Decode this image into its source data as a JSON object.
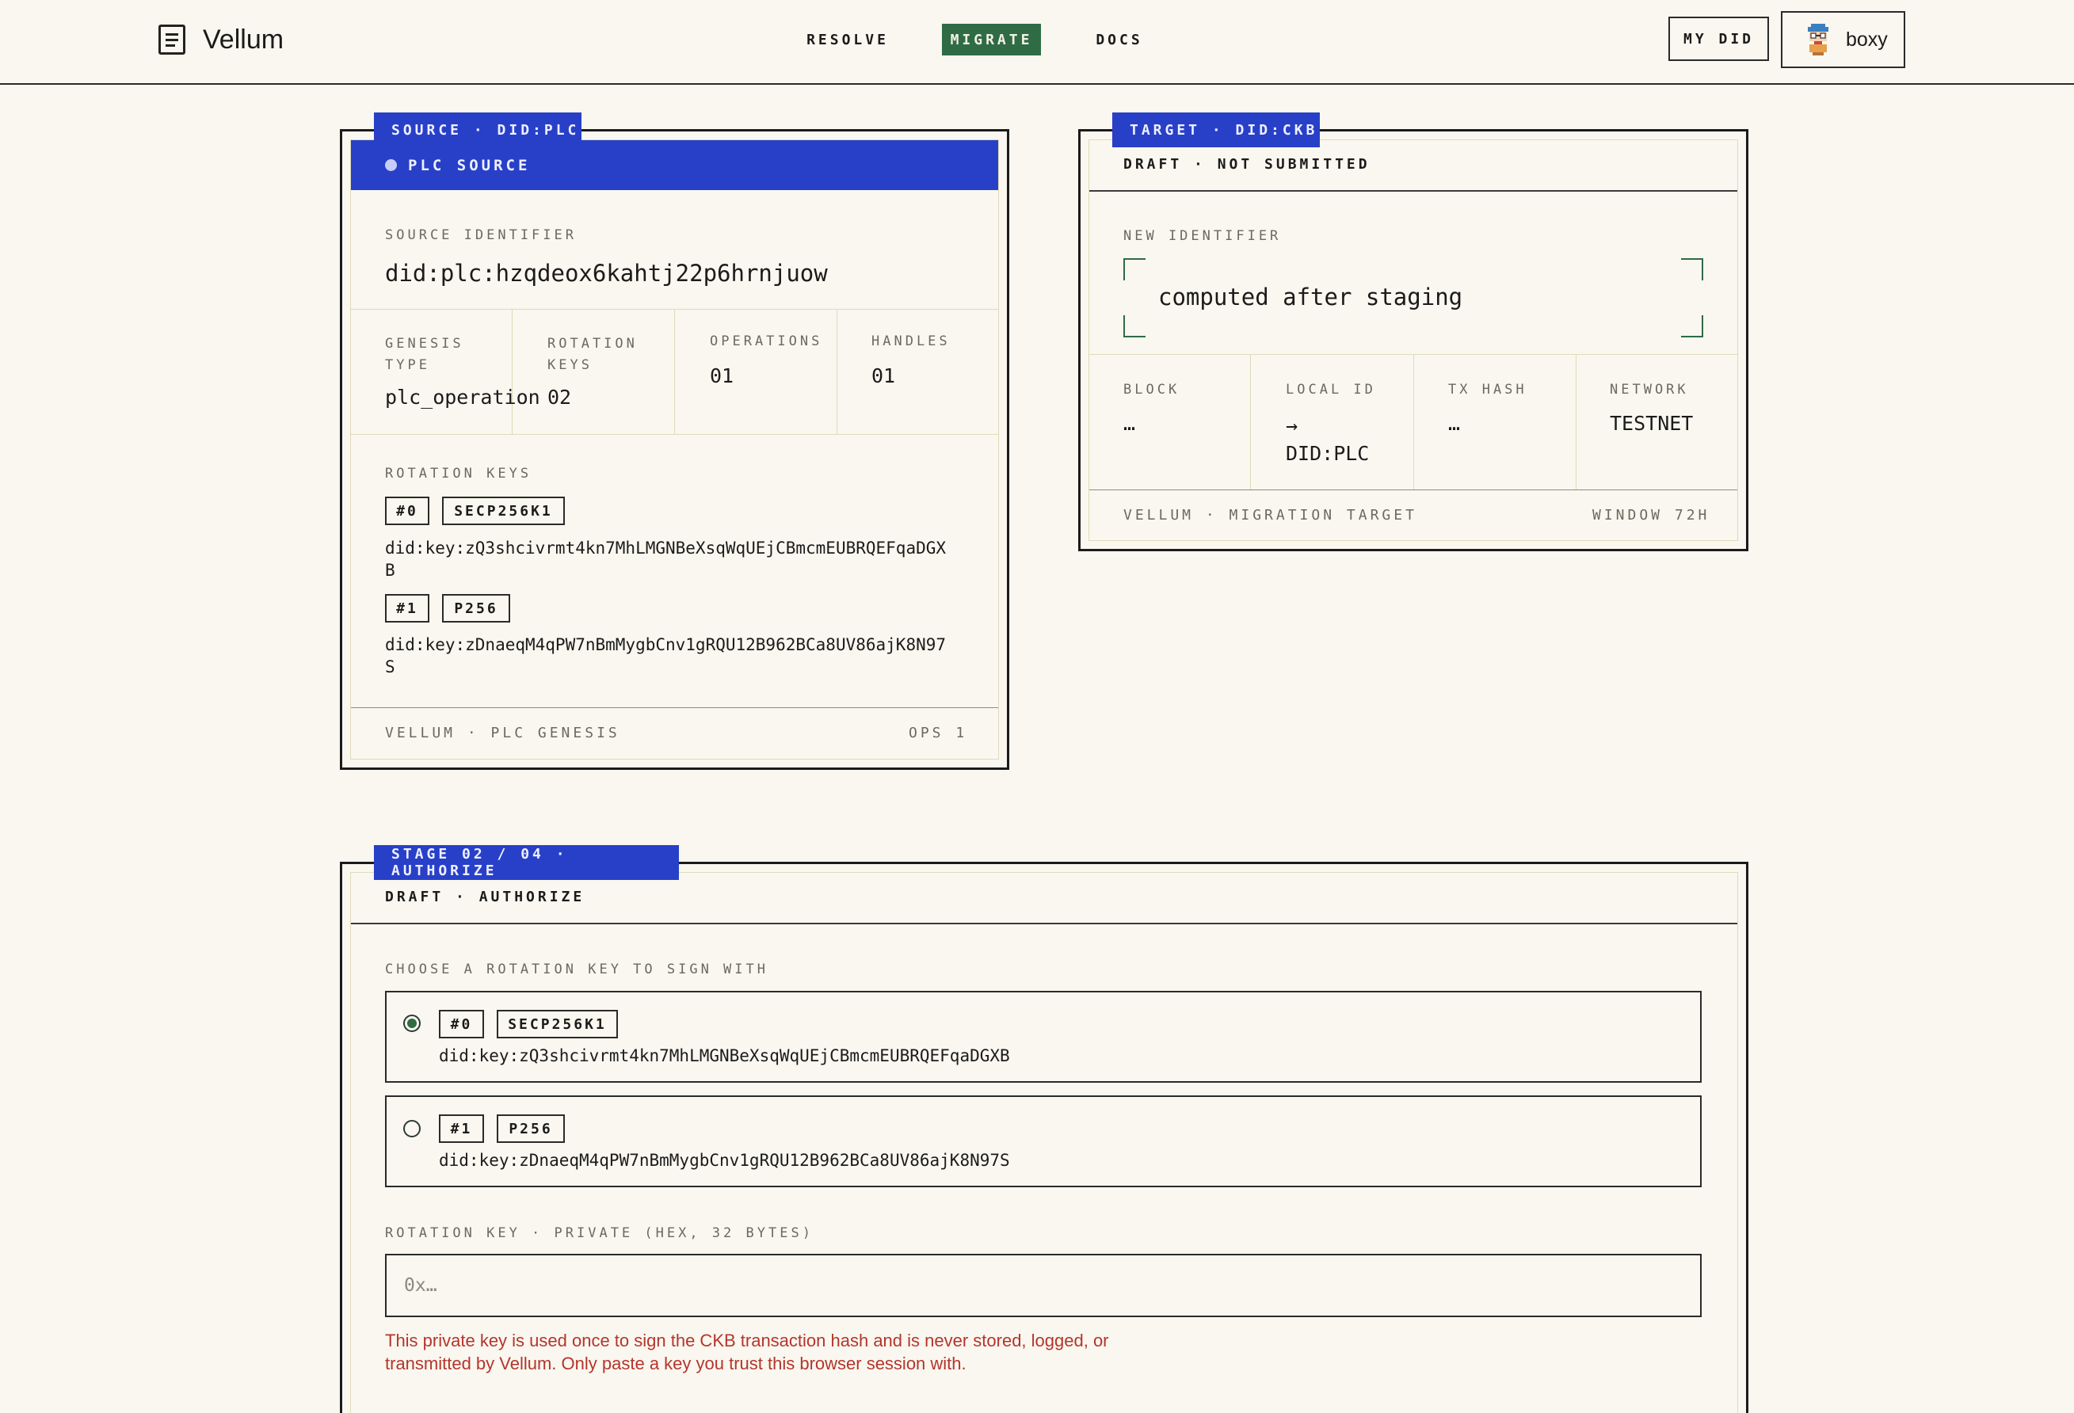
{
  "app": {
    "name": "Vellum",
    "nav": [
      {
        "label": "RESOLVE"
      },
      {
        "label": "MIGRATE"
      },
      {
        "label": "DOCS"
      }
    ],
    "my_did_label": "MY DID",
    "user_name": "boxy"
  },
  "source": {
    "tag": "SOURCE · DID:PLC",
    "banner": "PLC SOURCE",
    "identifier_label": "SOURCE IDENTIFIER",
    "identifier": "did:plc:hzqdeox6kahtj22p6hrnjuow",
    "stats": [
      {
        "label_line1": "GENESIS",
        "label_line2": "TYPE",
        "value": "plc_operation"
      },
      {
        "label_line1": "ROTATION",
        "label_line2": "KEYS",
        "value": "02"
      },
      {
        "label_line1": "OPERATIONS",
        "value": "01"
      },
      {
        "label_line1": "HANDLES",
        "value": "01"
      }
    ],
    "rotation_keys_label": "ROTATION KEYS",
    "keys": [
      {
        "index": "#0",
        "algo": "SECP256K1",
        "key_line1": "did:key:zQ3shcivrmt4kn7MhLMGNBeXsqWqUEjCBmcmEUBRQEFqaDGX",
        "key_line2": "B"
      },
      {
        "index": "#1",
        "algo": "P256",
        "key_line1": "did:key:zDnaeqM4qPW7nBmMygbCnv1gRQU12B962BCa8UV86ajK8N97",
        "key_line2": "S"
      }
    ],
    "footer_left": "VELLUM · PLC GENESIS",
    "footer_right": "OPS 1"
  },
  "target": {
    "tag": "TARGET · DID:CKB",
    "status": "DRAFT · NOT SUBMITTED",
    "new_identifier_label": "NEW IDENTIFIER",
    "new_identifier_value": "computed after staging",
    "fields": [
      {
        "label": "BLOCK",
        "value": "…"
      },
      {
        "label": "LOCAL ID",
        "value_line1": "→",
        "value_line2": "DID:PLC"
      },
      {
        "label": "TX HASH",
        "value": "…"
      },
      {
        "label": "NETWORK",
        "value": "TESTNET"
      }
    ],
    "footer_left": "VELLUM · MIGRATION TARGET",
    "footer_right": "WINDOW 72H"
  },
  "stage": {
    "tag": "STAGE 02 / 04 · AUTHORIZE",
    "status": "DRAFT · AUTHORIZE",
    "choose_label": "CHOOSE A ROTATION KEY TO SIGN WITH",
    "options": [
      {
        "index": "#0",
        "algo": "SECP256K1",
        "key": "did:key:zQ3shcivrmt4kn7MhLMGNBeXsqWqUEjCBmcmEUBRQEFqaDGXB",
        "selected": true
      },
      {
        "index": "#1",
        "algo": "P256",
        "key": "did:key:zDnaeqM4qPW7nBmMygbCnv1gRQU12B962BCa8UV86ajK8N97S",
        "selected": false
      }
    ],
    "private_key_label": "ROTATION KEY · PRIVATE (HEX, 32 BYTES)",
    "private_key_value": "",
    "private_key_placeholder": "0x…",
    "warning_line1": "This private key is used once to sign the CKB transaction hash and is never stored, logged, or",
    "warning_line2": "transmitted by Vellum. Only paste a key you trust this browser session with."
  },
  "colors": {
    "accent_blue": "#2840c8",
    "accent_green": "#2f6b45",
    "background": "#f9f7ef",
    "warning": "#b5352c"
  },
  "icons": {
    "brand": "document-icon",
    "avatar": "pixel-avatar-icon",
    "banner_dot": "status-dot-icon"
  }
}
